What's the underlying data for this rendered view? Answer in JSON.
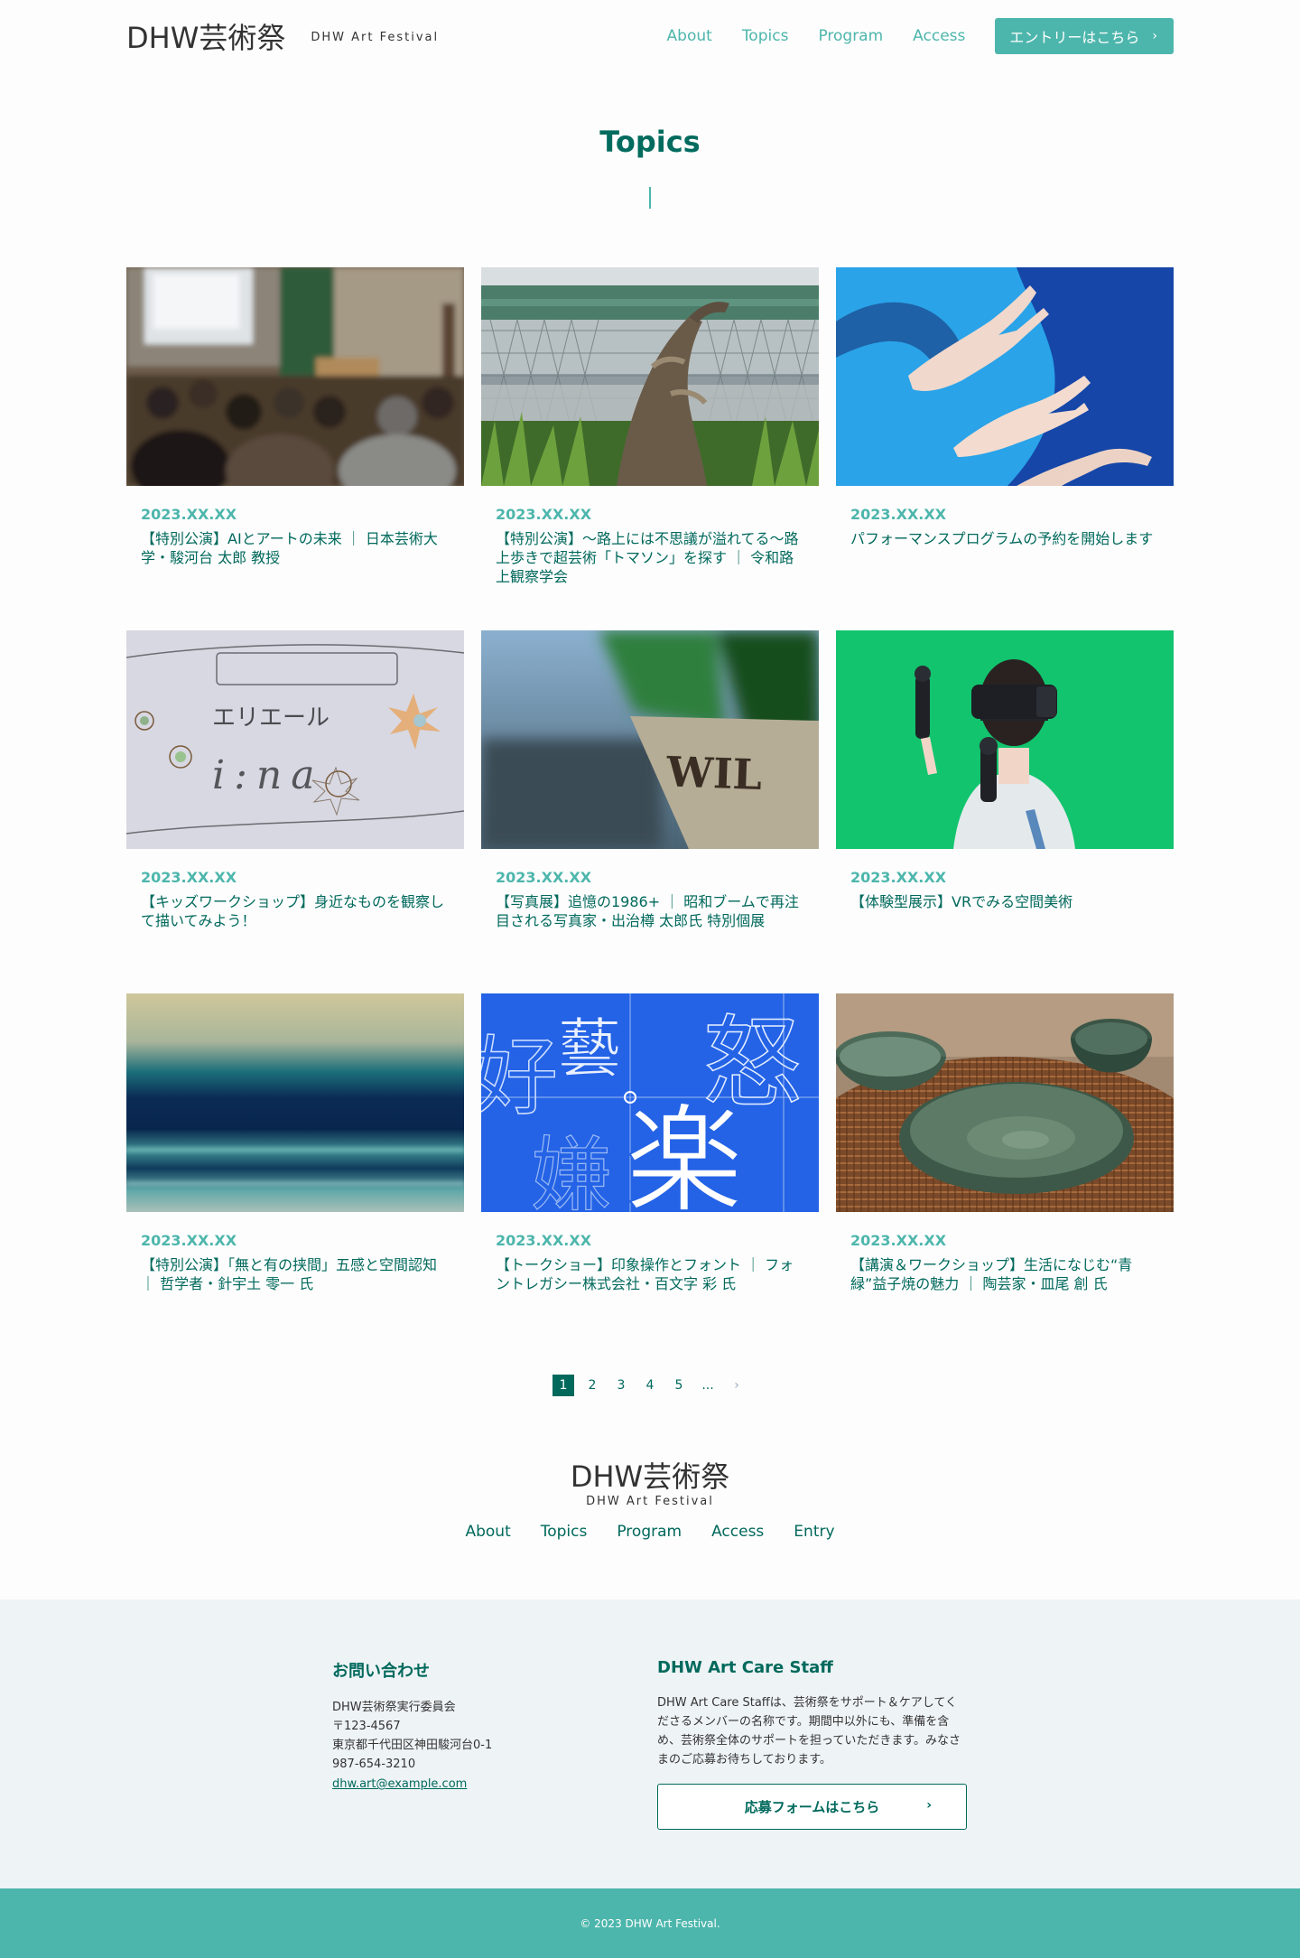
{
  "header": {
    "brand_name": "DHW芸術祭",
    "brand_sub": "DHW Art Festival",
    "nav": [
      "About",
      "Topics",
      "Program",
      "Access"
    ],
    "entry_label": "エントリーはこちら",
    "entry_icon": "chevron-right-icon"
  },
  "page": {
    "title": "Topics"
  },
  "topics": [
    {
      "date": "2023.XX.XX",
      "title": "【特別公演】AIとアートの未来 ｜ 日本芸術大学・駿河台 太郎 教授"
    },
    {
      "date": "2023.XX.XX",
      "title": "【特別公演】〜路上には不思議が溢れてる〜路上歩きで超芸術「トマソン」を探す ｜ 令和路上観察学会"
    },
    {
      "date": "2023.XX.XX",
      "title": "パフォーマンスプログラムの予約を開始します"
    },
    {
      "date": "2023.XX.XX",
      "title": "【キッズワークショップ】身近なものを観察して描いてみよう！"
    },
    {
      "date": "2023.XX.XX",
      "title": "【写真展】追憶の1986+ ｜ 昭和ブームで再注目される写真家・出治樽 太郎氏 特別個展"
    },
    {
      "date": "2023.XX.XX",
      "title": "【体験型展示】VRでみる空間美術"
    },
    {
      "date": "2023.XX.XX",
      "title": "【特別公演】「無と有の挟間」五感と空間認知 ｜ 哲学者・針宇土 零一 氏"
    },
    {
      "date": "2023.XX.XX",
      "title": "【トークショー】印象操作とフォント ｜ フォントレガシー株式会社・百文字 彩 氏"
    },
    {
      "date": "2023.XX.XX",
      "title": "【講演＆ワークショップ】生活になじむ“青緑”益子焼の魅力 ｜ 陶芸家・皿尾 創 氏"
    }
  ],
  "image_text": {
    "sign": "WIL",
    "kids_top": "エリエール",
    "kids_bottom": "i:na",
    "glyphs": [
      "好",
      "嫌",
      "楽",
      "怒",
      "藝"
    ]
  },
  "pagination": {
    "pages": [
      "1",
      "2",
      "3",
      "4",
      "5"
    ],
    "ellipsis": "...",
    "next": "›",
    "current": "1"
  },
  "footer": {
    "brand_name": "DHW芸術祭",
    "brand_sub": "DHW Art Festival",
    "nav": [
      "About",
      "Topics",
      "Program",
      "Access",
      "Entry"
    ]
  },
  "contact": {
    "heading": "お問い合わせ",
    "org": "DHW芸術祭実行委員会",
    "zip": "〒123-4567",
    "address": "東京都千代田区神田駿河台0-1",
    "phone": "987-654-3210",
    "email": "dhw.art@example.com"
  },
  "staff": {
    "heading": "DHW Art Care Staff",
    "description": "DHW Art Care Staffは、芸術祭をサポート＆ケアしてくださるメンバーの名称です。期間中以外にも、準備を含め、芸術祭全体のサポートを担っていただきます。みなさまのご応募お待ちしております。",
    "button": "応募フォームはこちら",
    "button_icon": "chevron-right-icon"
  },
  "copyright": "© 2023 DHW Art Festival.",
  "colors": {
    "accent": "#4db6ac",
    "dark": "#00695c",
    "info_bg": "#eef3f5"
  }
}
